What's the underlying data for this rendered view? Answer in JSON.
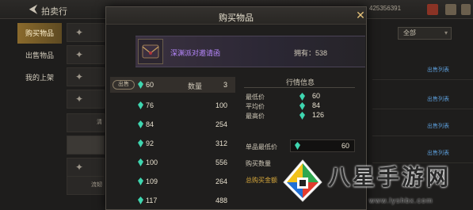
{
  "topbar": {
    "title": "拍卖行",
    "back_icon": "arrow-left-icon",
    "currency_text": "425356391"
  },
  "sidebar": {
    "items": [
      {
        "label": "购买物品",
        "active": true
      },
      {
        "label": "出售物品",
        "active": false
      },
      {
        "label": "我的上架",
        "active": false
      }
    ]
  },
  "background": {
    "filter_label": "全部",
    "listing_link": "出售列表",
    "slot_labels": [
      "清",
      "清",
      "流韧"
    ]
  },
  "dialog": {
    "title": "购买物品",
    "item": {
      "name": "深渊派对邀请函",
      "owned_text": "拥有：538"
    },
    "listings": [
      {
        "tag": "出售",
        "price": "60",
        "qty_label": "数量",
        "qty": "3",
        "selected": true
      },
      {
        "price": "76",
        "qty": "100"
      },
      {
        "price": "84",
        "qty": "254"
      },
      {
        "price": "92",
        "qty": "312"
      },
      {
        "price": "100",
        "qty": "556"
      },
      {
        "price": "109",
        "qty": "264"
      },
      {
        "price": "117",
        "qty": "488"
      }
    ],
    "market": {
      "title": "行情信息",
      "stats": [
        {
          "label": "最低价",
          "value": "60"
        },
        {
          "label": "平均价",
          "value": "84"
        },
        {
          "label": "最高价",
          "value": "126"
        }
      ]
    },
    "unit_price_label": "单品最低价",
    "unit_price_value": "60",
    "buy_qty_label": "购买数量",
    "total_label": "总购买金额"
  },
  "colors": {
    "accent_gold": "#d9a93c",
    "item_purple": "#b889ff",
    "gem_green": "#3fd6b0",
    "link_blue": "#5b9bd6"
  },
  "watermark": {
    "text": "八星手游网",
    "sub": "www.lyshbx.com"
  }
}
